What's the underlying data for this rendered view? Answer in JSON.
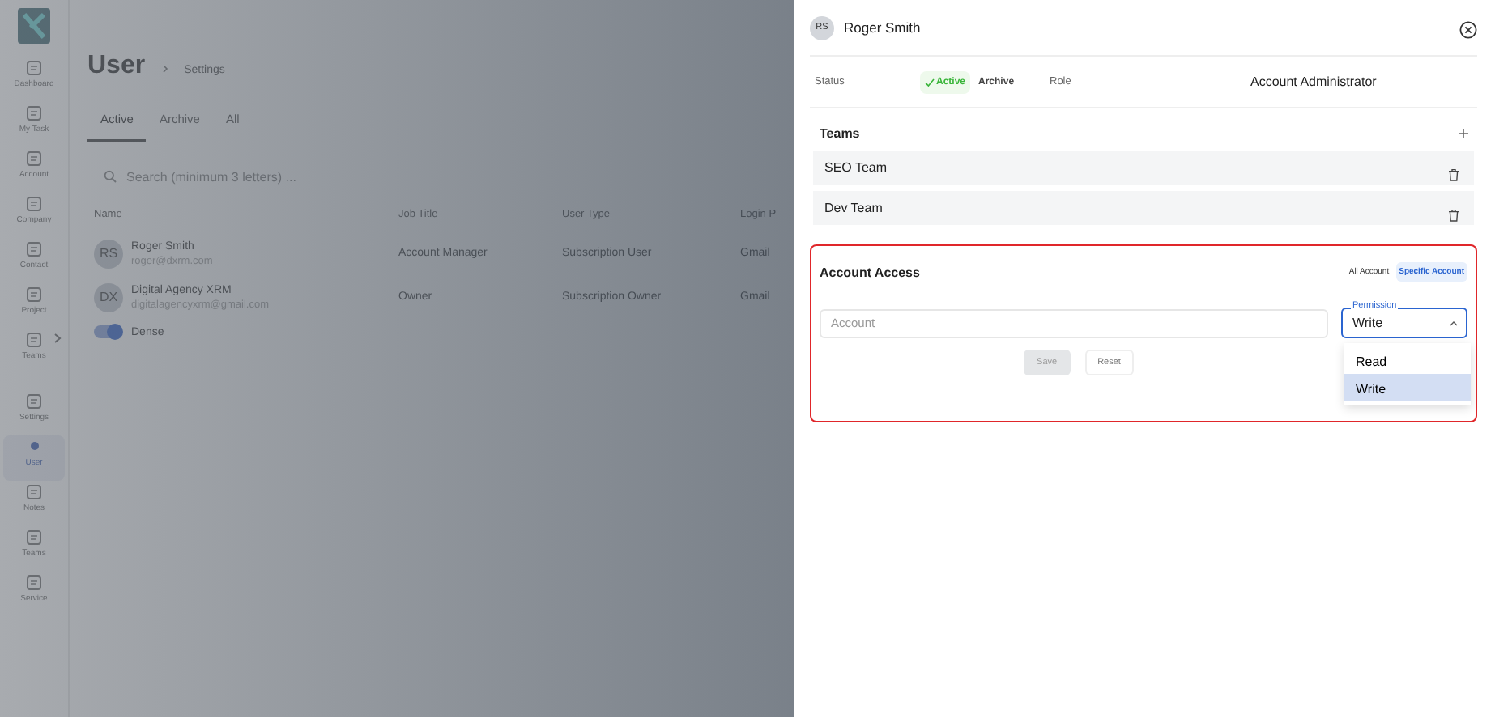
{
  "sidebar": {
    "items": [
      {
        "label": "Dashboard",
        "selected": false,
        "expandable": false
      },
      {
        "label": "My Task",
        "selected": false,
        "expandable": false
      },
      {
        "label": "Account",
        "selected": false,
        "expandable": false
      },
      {
        "label": "Company",
        "selected": false,
        "expandable": false
      },
      {
        "label": "Contact",
        "selected": false,
        "expandable": false
      },
      {
        "label": "Project",
        "selected": false,
        "expandable": false
      },
      {
        "label": "Teams",
        "selected": false,
        "expandable": true
      },
      {
        "label": "Settings",
        "selected": false,
        "expandable": false
      },
      {
        "label": "User",
        "selected": true,
        "expandable": false
      },
      {
        "label": "Notes",
        "selected": false,
        "expandable": false
      },
      {
        "label": "Teams",
        "selected": false,
        "expandable": false
      },
      {
        "label": "Service",
        "selected": false,
        "expandable": false
      }
    ]
  },
  "page": {
    "title": "User",
    "breadcrumb": "Settings",
    "tabs": [
      {
        "label": "Active",
        "selected": true
      },
      {
        "label": "Archive",
        "selected": false
      },
      {
        "label": "All",
        "selected": false
      }
    ],
    "search": {
      "placeholder": "Search (minimum 3 letters) ..."
    },
    "table": {
      "columns": [
        "Name",
        "Job Title",
        "User Type",
        "Login P"
      ],
      "rows": [
        {
          "initials": "RS",
          "name": "Roger Smith",
          "email": "roger@dxrm.com",
          "job_title": "Account Manager",
          "user_type": "Subscription User",
          "login": "Gmail"
        },
        {
          "initials": "DX",
          "name": "Digital Agency XRM",
          "email": "digitalagencyxrm@gmail.com",
          "job_title": "Owner",
          "user_type": "Subscription Owner",
          "login": "Gmail"
        }
      ]
    },
    "dense": {
      "label": "Dense",
      "on": true
    }
  },
  "drawer": {
    "user": {
      "initials": "RS",
      "name": "Roger Smith"
    },
    "status": {
      "label": "Status",
      "options": [
        {
          "label": "Active",
          "selected": true
        },
        {
          "label": "Archive",
          "selected": false
        }
      ]
    },
    "role": {
      "label": "Role",
      "value": "Account Administrator"
    },
    "teams": {
      "title": "Teams",
      "items": [
        {
          "name": "SEO Team"
        },
        {
          "name": "Dev Team"
        }
      ]
    },
    "access": {
      "title": "Account Access",
      "scope_options": [
        {
          "label": "All Account",
          "selected": false
        },
        {
          "label": "Specific Account",
          "selected": true
        }
      ],
      "account_field": {
        "placeholder": "Account"
      },
      "permission": {
        "label": "Permission",
        "value": "Write",
        "expanded": true,
        "options": [
          {
            "label": "Read",
            "selected": false
          },
          {
            "label": "Write",
            "selected": true
          }
        ]
      },
      "buttons": [
        {
          "label": "Save",
          "disabled": true
        },
        {
          "label": "Reset",
          "disabled": false
        }
      ]
    }
  }
}
